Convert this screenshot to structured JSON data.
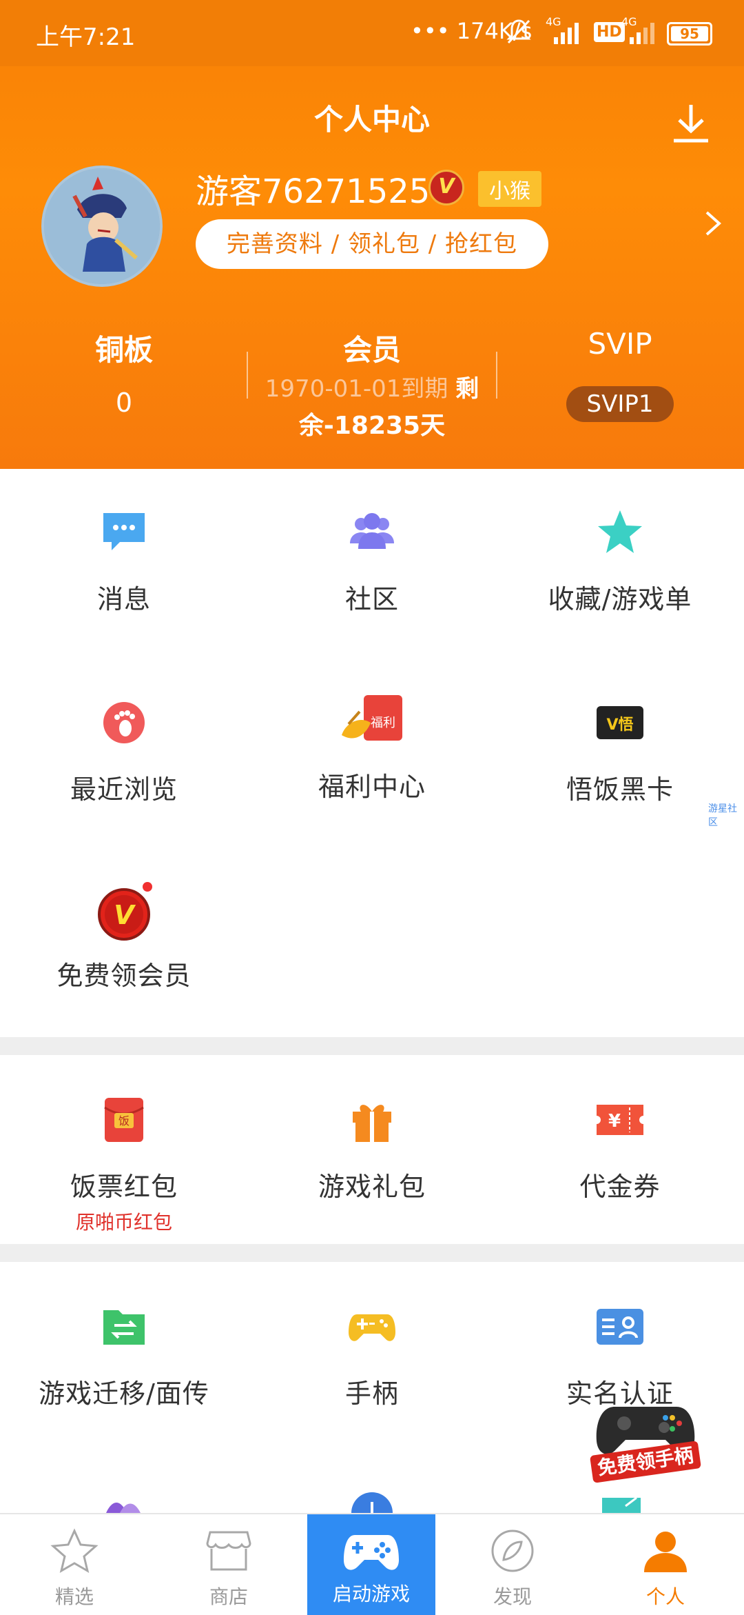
{
  "status_bar": {
    "time": "上午7:21",
    "speed": "174K/s",
    "net1": "4G",
    "net2": "4G",
    "hd": "HD",
    "battery": "95"
  },
  "header": {
    "title": "个人中心",
    "username": "游客76271525",
    "vip_badge": "V",
    "tag": "小猴",
    "action_pill": "完善资料 / 领礼包 / 抢红包",
    "stats": {
      "copper_label": "铜板",
      "copper_value": "0",
      "member_label": "会员",
      "member_expiry_line1": "1970-01-01到期",
      "member_expiry_line1b": "剩",
      "member_expiry_line2": "余-18235天",
      "svip_label": "SVIP",
      "svip_level": "SVIP1"
    }
  },
  "grid1": [
    {
      "label": "消息",
      "icon": "message-icon"
    },
    {
      "label": "社区",
      "icon": "community-icon"
    },
    {
      "label": "收藏/游戏单",
      "icon": "star-icon"
    },
    {
      "label": "最近浏览",
      "icon": "footprint-icon"
    },
    {
      "label": "福利中心",
      "icon": "welfare-icon",
      "icon_text": "福利"
    },
    {
      "label": "悟饭黑卡",
      "icon": "black-card-icon",
      "icon_text": "V悟"
    },
    {
      "label": "免费领会员",
      "icon": "vip-icon",
      "icon_text": "V"
    }
  ],
  "side_link": "游星社区",
  "grid2": [
    {
      "label": "饭票红包",
      "sub": "原啪币红包",
      "icon": "red-envelope-icon",
      "icon_text": "饭"
    },
    {
      "label": "游戏礼包",
      "icon": "gift-icon"
    },
    {
      "label": "代金券",
      "icon": "coupon-icon",
      "icon_text": "¥"
    }
  ],
  "grid3": [
    {
      "label": "游戏迁移/面传",
      "icon": "transfer-icon"
    },
    {
      "label": "手柄",
      "icon": "gamepad-icon"
    },
    {
      "label": "实名认证",
      "icon": "id-card-icon"
    }
  ],
  "floating_promo": "免费领手柄",
  "bottom_nav": [
    {
      "label": "精选",
      "icon": "star-outline-icon"
    },
    {
      "label": "商店",
      "icon": "shop-icon"
    },
    {
      "label": "启动游戏",
      "icon": "gamepad-nav-icon"
    },
    {
      "label": "发现",
      "icon": "compass-icon"
    },
    {
      "label": "个人",
      "icon": "person-icon"
    }
  ],
  "colors": {
    "primary": "#fe8c07",
    "active_tab": "#2f8cf3",
    "accent_red": "#e0312b"
  }
}
